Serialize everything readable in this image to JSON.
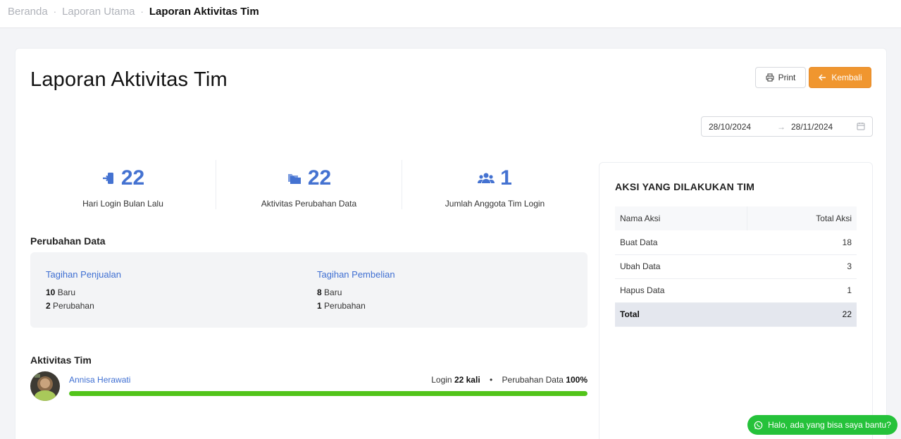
{
  "breadcrumb": {
    "items": [
      "Beranda",
      "Laporan Utama"
    ],
    "separator": "·",
    "current": "Laporan Aktivitas Tim"
  },
  "page": {
    "title": "Laporan Aktivitas Tim",
    "print_label": "Print",
    "back_label": "Kembali"
  },
  "date_range": {
    "start": "28/10/2024",
    "arrow": "→",
    "end": "28/11/2024"
  },
  "stats": [
    {
      "value": "22",
      "label": "Hari Login Bulan Lalu",
      "icon": "login-icon"
    },
    {
      "value": "22",
      "label": "Aktivitas Perubahan Data",
      "icon": "folders-icon"
    },
    {
      "value": "1",
      "label": "Jumlah Anggota Tim Login",
      "icon": "users-icon"
    }
  ],
  "data_changes": {
    "title": "Perubahan Data",
    "items": [
      {
        "title": "Tagihan Penjualan",
        "new_count": "10",
        "new_label": "Baru",
        "change_count": "2",
        "change_label": "Perubahan"
      },
      {
        "title": "Tagihan Pembelian",
        "new_count": "8",
        "new_label": "Baru",
        "change_count": "1",
        "change_label": "Perubahan"
      }
    ]
  },
  "team_activity": {
    "title": "Aktivitas Tim",
    "members": [
      {
        "name": "Annisa Herawati",
        "login_prefix": "Login",
        "login_value": "22 kali",
        "separator": "•",
        "change_prefix": "Perubahan Data",
        "change_value": "100%",
        "progress": 1.0
      }
    ]
  },
  "actions": {
    "title": "AKSI YANG DILAKUKAN TIM",
    "headers": [
      "Nama Aksi",
      "Total Aksi"
    ],
    "rows": [
      [
        "Buat Data",
        "18"
      ],
      [
        "Ubah Data",
        "3"
      ],
      [
        "Hapus Data",
        "1"
      ]
    ],
    "total": [
      "Total",
      "22"
    ]
  },
  "chat": {
    "label": "Halo, ada yang bisa saya bantu?"
  },
  "colors": {
    "accent_blue": "#4472d1",
    "orange": "#f0962f",
    "green": "#52c41a",
    "whatsapp_green": "#25c23a"
  }
}
